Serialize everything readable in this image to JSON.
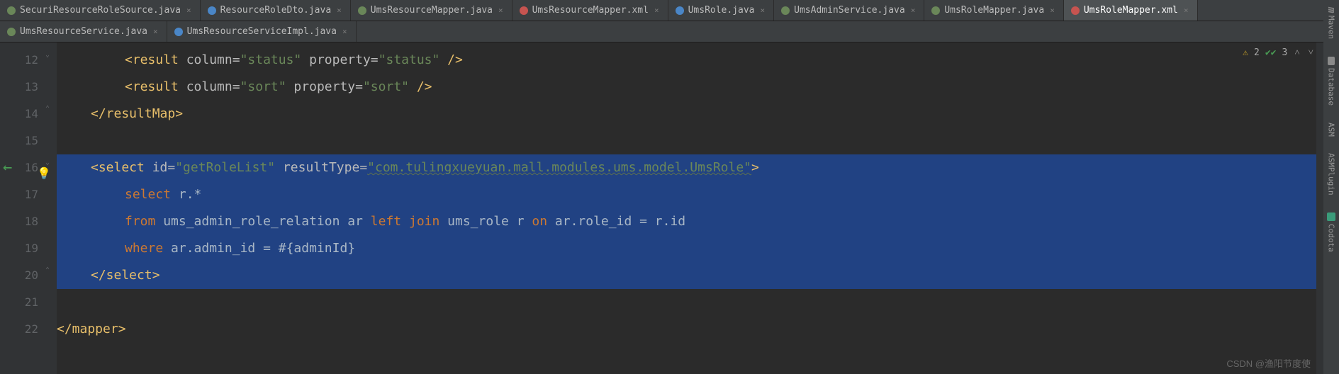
{
  "tabs_row1": [
    {
      "label": "SecuriResourceRoleSource.java",
      "icon": "green"
    },
    {
      "label": "ResourceRoleDto.java",
      "icon": "blue"
    },
    {
      "label": "UmsResourceMapper.java",
      "icon": "green"
    },
    {
      "label": "UmsResourceMapper.xml",
      "icon": "xml"
    },
    {
      "label": "UmsRole.java",
      "icon": "blue"
    },
    {
      "label": "UmsAdminService.java",
      "icon": "green"
    },
    {
      "label": "UmsRoleMapper.java",
      "icon": "green"
    },
    {
      "label": "UmsRoleMapper.xml",
      "icon": "xml",
      "active": true
    }
  ],
  "tabs_row2": [
    {
      "label": "UmsResourceService.java",
      "icon": "green"
    },
    {
      "label": "UmsResourceServiceImpl.java",
      "icon": "blue"
    }
  ],
  "gutter": [
    "12",
    "13",
    "14",
    "15",
    "16",
    "17",
    "18",
    "19",
    "20",
    "21",
    "22"
  ],
  "code": {
    "l12_a": "<result ",
    "l12_b": "column=",
    "l12_c": "\"status\"",
    "l12_d": " property=",
    "l12_e": "\"status\"",
    "l12_f": " />",
    "l13_a": "<result ",
    "l13_b": "column=",
    "l13_c": "\"sort\"",
    "l13_d": " property=",
    "l13_e": "\"sort\"",
    "l13_f": " />",
    "l14": "</resultMap>",
    "l15": "",
    "l16_a": "<select ",
    "l16_b": "id=",
    "l16_c": "\"getRoleList\"",
    "l16_d": " resultType=",
    "l16_e": "\"com.tulingxueyuan.mall.modules.ums.model.UmsRole\"",
    "l16_f": ">",
    "l17_a": "select ",
    "l17_b": "r.*",
    "l18_a": "from ",
    "l18_b": "ums_admin_role_relation ar ",
    "l18_c": "left join ",
    "l18_d": "ums_role r ",
    "l18_e": "on ",
    "l18_f": "ar.role_id = r.id",
    "l19_a": "where ",
    "l19_b": "ar.admin_id = #{adminId}",
    "l20": "</select>",
    "l21": "",
    "l22": "</mapper>"
  },
  "inspection": {
    "warn_count": "2",
    "ok_count": "3"
  },
  "tools": {
    "maven": "Maven",
    "database": "Database",
    "asm": "ASM",
    "asmplugin": "ASMPlugin",
    "codota": "Codota"
  },
  "watermark": "CSDN @渔阳节度使"
}
